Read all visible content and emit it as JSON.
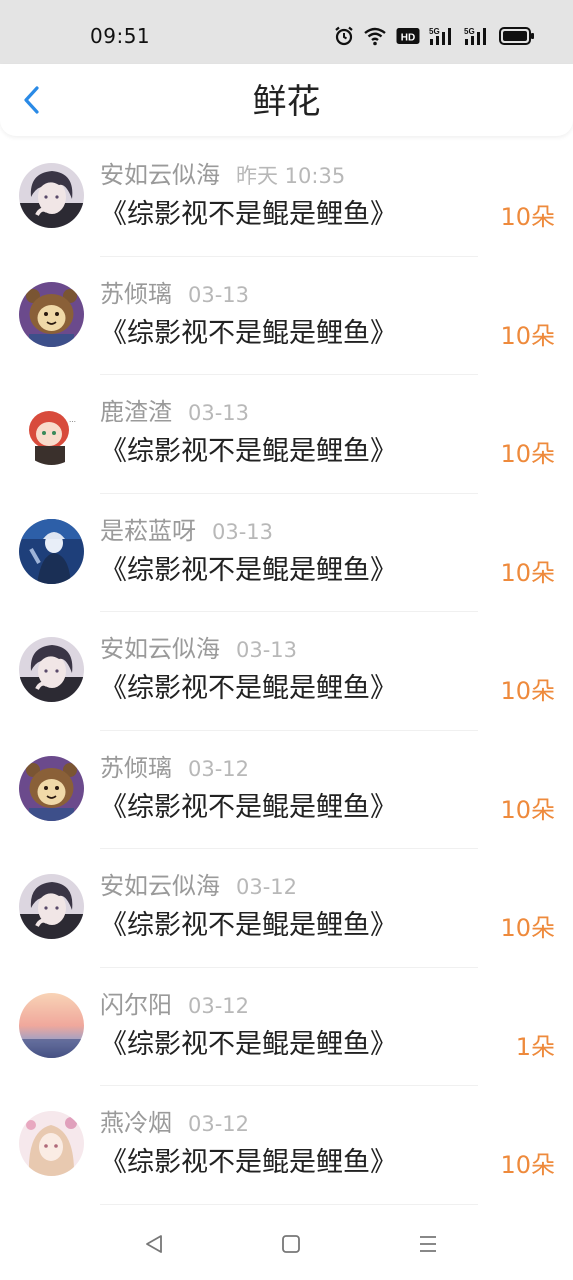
{
  "status_bar": {
    "time": "09:51",
    "icons": [
      "alarm-icon",
      "wifi-icon",
      "hd-icon",
      "5g-signal-icon",
      "5g-signal-icon",
      "battery-icon"
    ],
    "hd_label": "HD",
    "net_label": "5G"
  },
  "header": {
    "title": "鲜花",
    "back_icon": "chevron-left-icon",
    "accent_color": "#2a8ae6"
  },
  "rows": [
    {
      "name": "安如云似海",
      "time": "昨天 10:35",
      "title": "《综影视不是鲲是鲤鱼》",
      "count": "10朵",
      "avatar": "boy-dark"
    },
    {
      "name": "苏倾璃",
      "time": "03-13",
      "title": "《综影视不是鲲是鲤鱼》",
      "count": "10朵",
      "avatar": "bear-purple"
    },
    {
      "name": "鹿渣渣",
      "time": "03-13",
      "title": "《综影视不是鲲是鲤鱼》",
      "count": "10朵",
      "avatar": "chibi-red"
    },
    {
      "name": "是菘蓝呀",
      "time": "03-13",
      "title": "《综影视不是鲲是鲤鱼》",
      "count": "10朵",
      "avatar": "blue-figure"
    },
    {
      "name": "安如云似海",
      "time": "03-13",
      "title": "《综影视不是鲲是鲤鱼》",
      "count": "10朵",
      "avatar": "boy-dark"
    },
    {
      "name": "苏倾璃",
      "time": "03-12",
      "title": "《综影视不是鲲是鲤鱼》",
      "count": "10朵",
      "avatar": "bear-purple"
    },
    {
      "name": "安如云似海",
      "time": "03-12",
      "title": "《综影视不是鲲是鲤鱼》",
      "count": "10朵",
      "avatar": "boy-dark"
    },
    {
      "name": "闪尔阳",
      "time": "03-12",
      "title": "《综影视不是鲲是鲤鱼》",
      "count": "1朵",
      "avatar": "sunset"
    },
    {
      "name": "燕冷烟",
      "time": "03-12",
      "title": "《综影视不是鲲是鲤鱼》",
      "count": "10朵",
      "avatar": "girl-pink"
    }
  ],
  "bottom_nav": {
    "icons": [
      "back-triangle-icon",
      "home-square-icon",
      "menu-lines-icon"
    ]
  },
  "colors": {
    "count_orange": "#ee8a3c",
    "status_bar_bg": "#e4e4e4",
    "name_gray": "#9a9a9a",
    "time_gray": "#b8b8b8"
  }
}
